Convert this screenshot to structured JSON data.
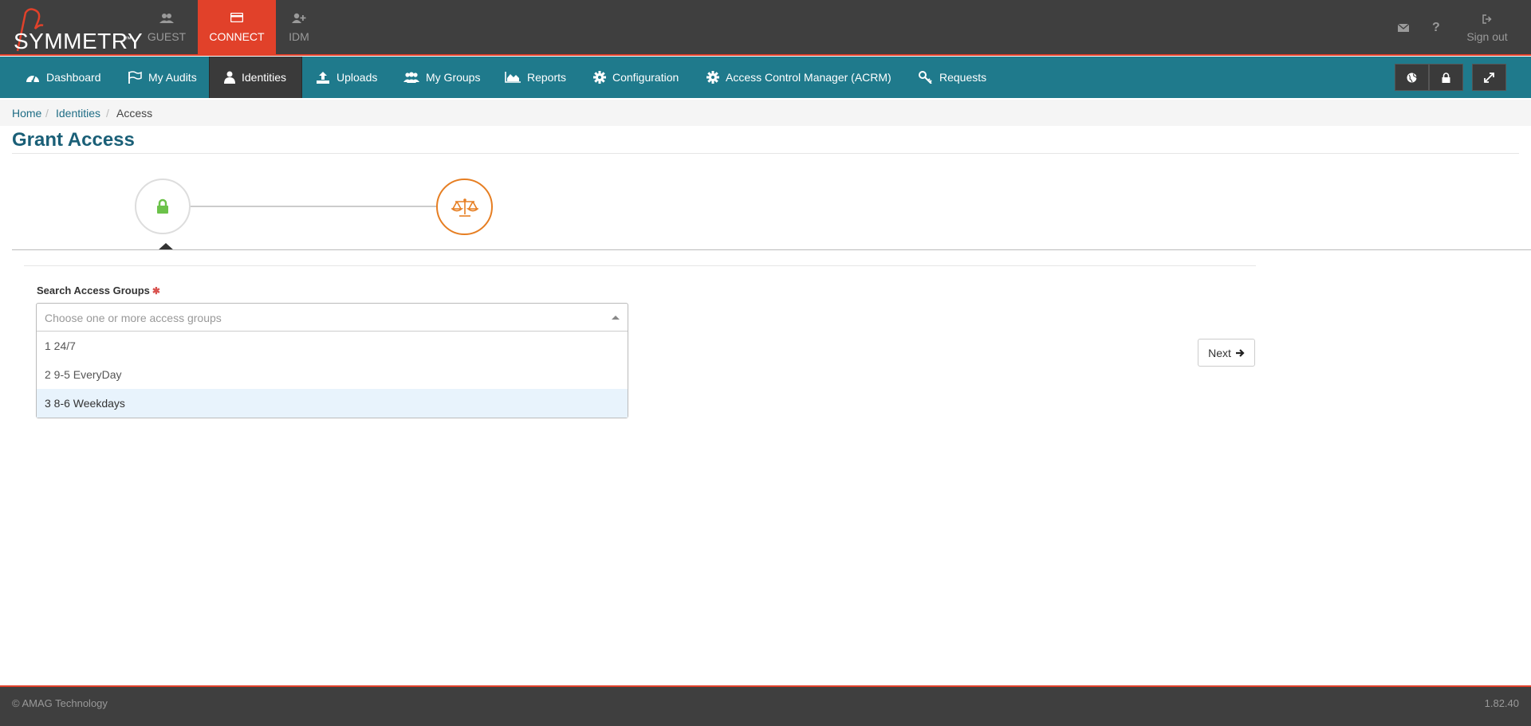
{
  "brand": {
    "name": "SYMMETRY",
    "tm": "™"
  },
  "modules": [
    {
      "label": "GUEST",
      "icon": "users-icon"
    },
    {
      "label": "CONNECT",
      "icon": "card-icon",
      "active": true
    },
    {
      "label": "IDM",
      "icon": "user-plus-icon"
    }
  ],
  "top_right": {
    "sign_out": "Sign out"
  },
  "nav": [
    {
      "label": "Dashboard",
      "icon": "dashboard-icon"
    },
    {
      "label": "My Audits",
      "icon": "flag-icon"
    },
    {
      "label": "Identities",
      "icon": "user-icon",
      "active": true
    },
    {
      "label": "Uploads",
      "icon": "upload-icon"
    },
    {
      "label": "My Groups",
      "icon": "users-icon"
    },
    {
      "label": "Reports",
      "icon": "area-chart-icon"
    },
    {
      "label": "Configuration",
      "icon": "gear-icon"
    },
    {
      "label": "Access Control Manager (ACRM)",
      "icon": "gear-icon"
    },
    {
      "label": "Requests",
      "icon": "key-icon"
    }
  ],
  "breadcrumb": {
    "home": "Home",
    "identities": "Identities",
    "current": "Access",
    "sep": "/"
  },
  "page_title": "Grant Access",
  "form": {
    "label": "Search Access Groups",
    "required_mark": "✱",
    "placeholder": "Choose one or more access groups",
    "options": [
      "1 24/7",
      "2 9-5 EveryDay",
      "3 8-6 Weekdays"
    ],
    "highlighted_option": "3 8-6 Weekdays"
  },
  "next_button": "Next",
  "footer": {
    "copyright": "© AMAG Technology",
    "version": "1.82.40"
  },
  "colors": {
    "accent": "#e1412a",
    "nav": "#1f7a8c",
    "dark": "#3f3f3f",
    "lock": "#6cc24a",
    "scale": "#e67e22"
  }
}
